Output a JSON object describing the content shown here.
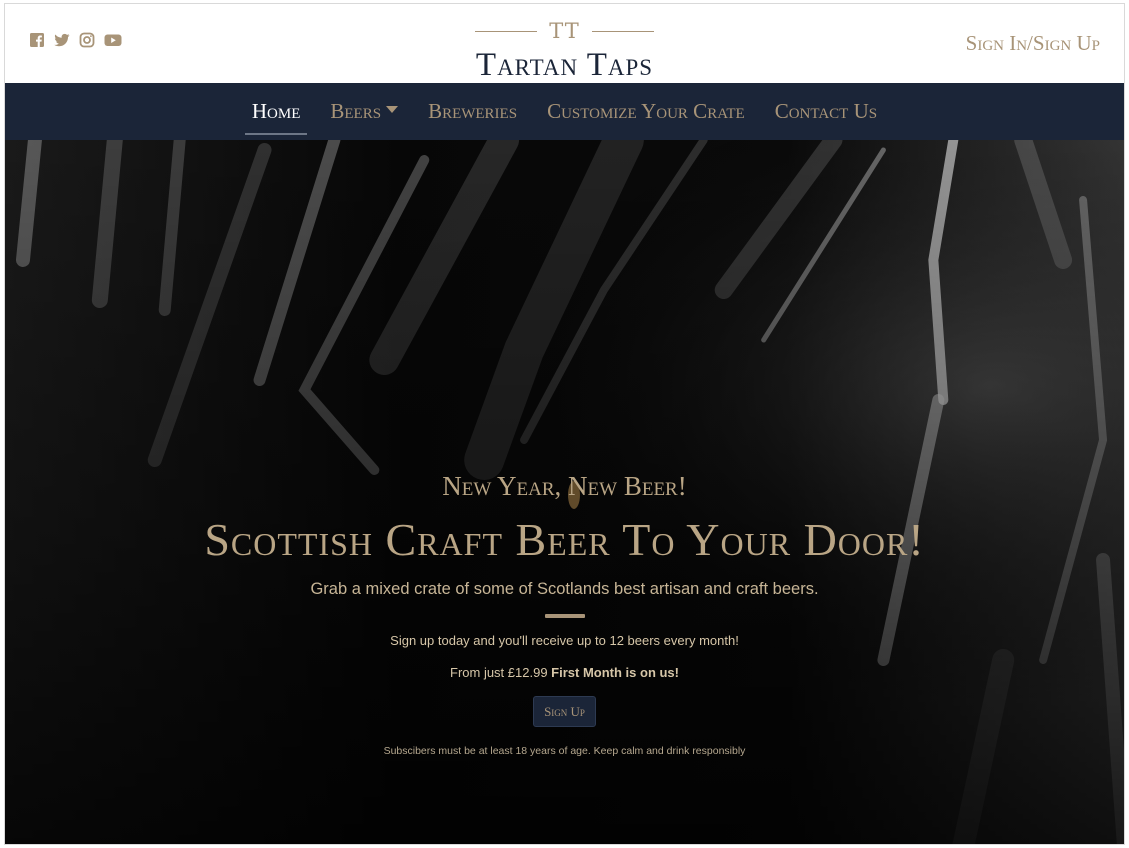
{
  "header": {
    "social_icons": [
      "facebook-icon",
      "twitter-icon",
      "instagram-icon",
      "youtube-icon"
    ],
    "monogram": "TT",
    "brand_name": "Tartan Taps",
    "signin_label": "Sign In/Sign Up"
  },
  "nav": {
    "items": [
      {
        "label": "Home",
        "active": true
      },
      {
        "label": "Beers",
        "dropdown": true
      },
      {
        "label": "Breweries"
      },
      {
        "label": "Customize Your Crate"
      },
      {
        "label": "Contact Us"
      }
    ]
  },
  "hero": {
    "kicker": "New Year, New Beer!",
    "headline": "Scottish Craft Beer To Your Door!",
    "lead": "Grab a mixed crate of some of Scotlands best artisan and craft beers.",
    "offer_line": "Sign up today and you'll receive up to 12 beers every month!",
    "price_prefix": "From just £12.99",
    "price_highlight": "First Month is on us!",
    "cta_label": "Sign Up",
    "disclaimer": "Subscibers must be at least 18 years of age. Keep calm and drink responsibly"
  },
  "colors": {
    "navy": "#1b2538",
    "gold": "#a89478",
    "hero_text": "#b9a585"
  }
}
